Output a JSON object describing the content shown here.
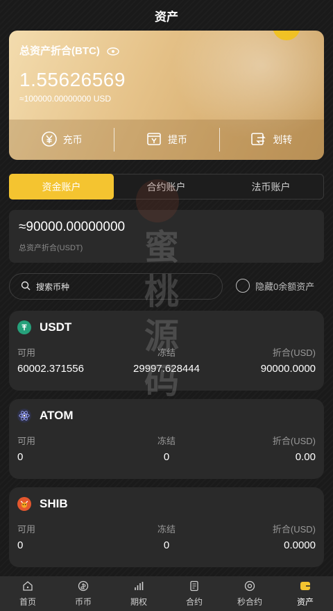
{
  "header": {
    "title": "资产"
  },
  "asset_card": {
    "title": "总资产折合(BTC)",
    "balance": "1.55626569",
    "balance_usd": "≈100000.00000000 USD",
    "actions": [
      {
        "label": "充币",
        "icon": "deposit-icon"
      },
      {
        "label": "提币",
        "icon": "withdraw-icon"
      },
      {
        "label": "划转",
        "icon": "transfer-icon"
      }
    ]
  },
  "tabs": [
    {
      "label": "资金账户",
      "active": true
    },
    {
      "label": "合约账户",
      "active": false
    },
    {
      "label": "法币账户",
      "active": false
    }
  ],
  "total": {
    "value": "≈90000.00000000",
    "label": "总资产折合(USDT)"
  },
  "search": {
    "placeholder": "搜索币种"
  },
  "hide_zero": {
    "label": "隐藏0余额资产"
  },
  "watermark": [
    "蜜",
    "桃",
    "源",
    "码"
  ],
  "coins": [
    {
      "name": "USDT",
      "labels": [
        "可用",
        "冻结",
        "折合(USD)"
      ],
      "available": "60002.371556",
      "frozen": "29997.628444",
      "value": "90000.0000",
      "color": "#26a17b"
    },
    {
      "name": "ATOM",
      "labels": [
        "可用",
        "冻结",
        "折合(USD)"
      ],
      "available": "0",
      "frozen": "0",
      "value": "0.00",
      "color": "#2e3148"
    },
    {
      "name": "SHIB",
      "labels": [
        "可用",
        "冻结",
        "折合(USD)"
      ],
      "available": "0",
      "frozen": "0",
      "value": "0.0000",
      "color": "#e4572e"
    }
  ],
  "nav": [
    {
      "label": "首页",
      "icon": "home-icon",
      "active": false
    },
    {
      "label": "币币",
      "icon": "coin-icon",
      "active": false
    },
    {
      "label": "期权",
      "icon": "chart-bars-icon",
      "active": false
    },
    {
      "label": "合约",
      "icon": "document-icon",
      "active": false
    },
    {
      "label": "秒合约",
      "icon": "target-icon",
      "active": false
    },
    {
      "label": "资产",
      "icon": "wallet-icon",
      "active": true
    }
  ]
}
